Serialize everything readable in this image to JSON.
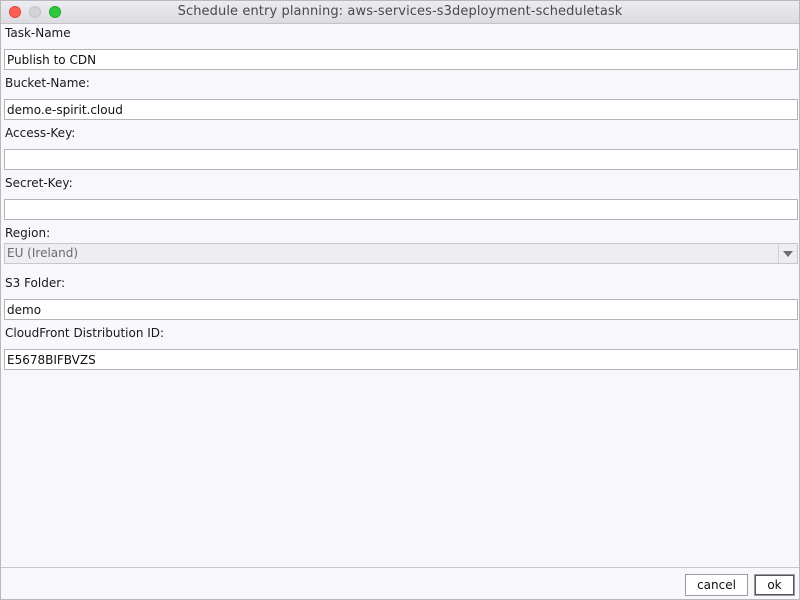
{
  "window": {
    "title": "Schedule entry planning: aws-services-s3deployment-scheduletask"
  },
  "form": {
    "task_name": {
      "label": "Task-Name",
      "value": "Publish to CDN"
    },
    "bucket_name": {
      "label": "Bucket-Name:",
      "value": "demo.e-spirit.cloud"
    },
    "access_key": {
      "label": "Access-Key:",
      "value": ""
    },
    "secret_key": {
      "label": "Secret-Key:",
      "value": ""
    },
    "region": {
      "label": "Region:",
      "selected": "EU (Ireland)"
    },
    "s3_folder": {
      "label": "S3 Folder:",
      "value": "demo"
    },
    "cloudfront_id": {
      "label": "CloudFront Distribution ID:",
      "value": "E5678BIFBVZS"
    }
  },
  "buttons": {
    "cancel": "cancel",
    "ok": "ok"
  },
  "icons": {
    "close": "close-icon",
    "minimize": "minimize-icon",
    "maximize": "maximize-icon",
    "dropdown": "chevron-down-icon"
  }
}
